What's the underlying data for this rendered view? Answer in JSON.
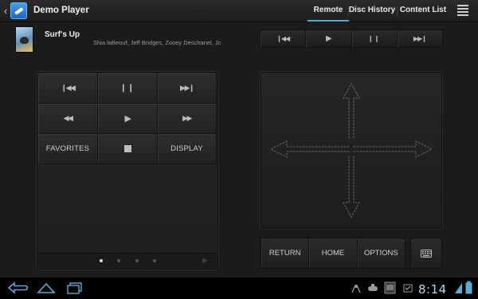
{
  "app": {
    "title": "Demo Player"
  },
  "tabs": [
    {
      "label": "Remote",
      "selected": true
    },
    {
      "label": "Disc History",
      "selected": false
    },
    {
      "label": "Content List",
      "selected": false
    }
  ],
  "now_playing": {
    "title": "Surf's Up",
    "cast": "Shia laBeouf, Jeff Bridges, Zooey Deschanel, Jc"
  },
  "top_transport": [
    "previous-icon",
    "play-icon",
    "pause-icon",
    "next-icon"
  ],
  "remote_grid": {
    "favorites_label": "FAVORITES",
    "display_label": "DISPLAY"
  },
  "pager": {
    "page_count": 4,
    "current_page": 1
  },
  "bottom_buttons": {
    "return_label": "RETURN",
    "home_label": "HOME",
    "options_label": "OPTIONS"
  },
  "system_bar": {
    "time": "8:14"
  },
  "colors": {
    "accent": "#33b5e5",
    "background": "#1b1b1b",
    "clock": "#a8d8ee"
  }
}
